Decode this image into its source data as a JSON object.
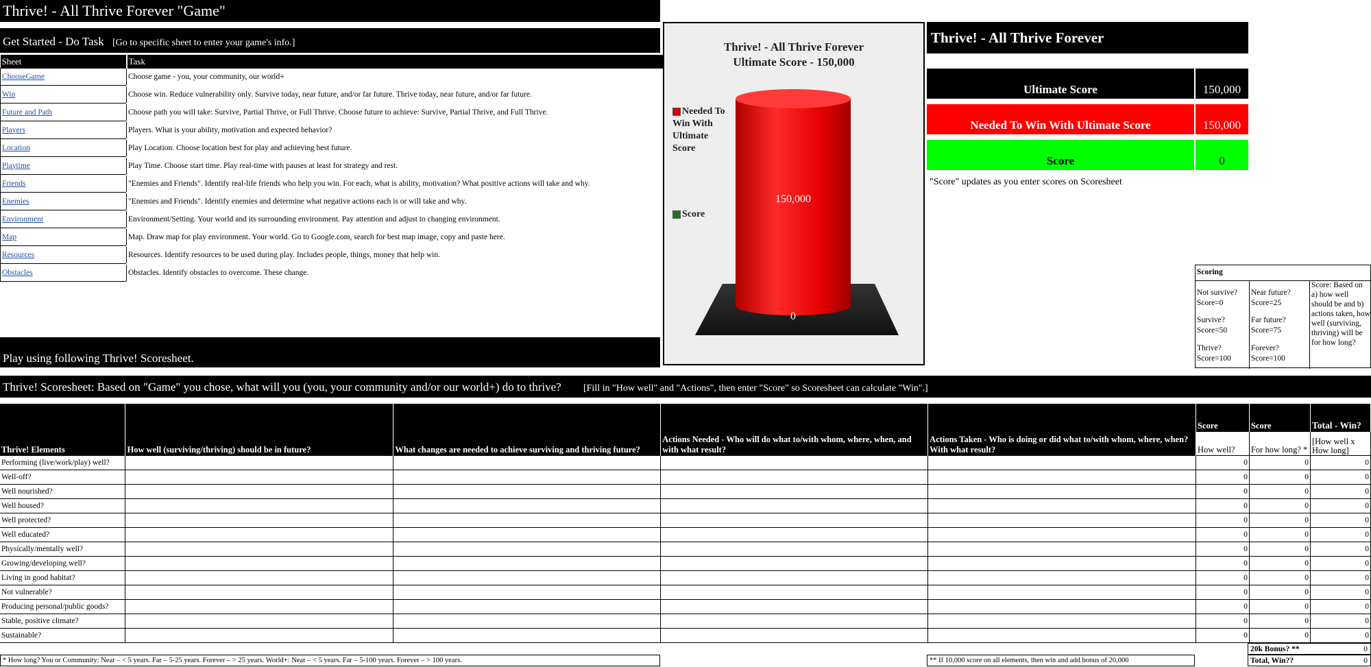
{
  "title": "Thrive! - All Thrive Forever \"Game\"",
  "get_started": {
    "heading": "Get Started - Do Task",
    "hint": "[Go to specific sheet to enter your game's info.]",
    "col_sheet": "Sheet",
    "col_task": "Task",
    "rows": [
      {
        "sheet": "ChooseGame",
        "task": "Choose game - you, your community, our world+"
      },
      {
        "sheet": "Win",
        "task": "Choose win. Reduce vulnerability only. Survive today, near future, and/or far future. Thrive today, near future, and/or far future."
      },
      {
        "sheet": "Future and Path",
        "task": "Choose path you will take: Survive, Partial Thrive, or Full Thrive. Choose future to achieve: Survive, Partial Thrive, and Full Thrive."
      },
      {
        "sheet": "Players",
        "task": "Players. What is your ability, motivation and expected behavior?"
      },
      {
        "sheet": "Location",
        "task": "Play Location. Choose location best for play and achieving best future."
      },
      {
        "sheet": "Playtime",
        "task": "Play Time. Choose start time. Play real-time with pauses at least for strategy and rest."
      },
      {
        "sheet": "Friends",
        "task": "\"Enemies and Friends\". Identify real-life friends who help you win. For each, what is ability, motivation? What positive actions will take and why."
      },
      {
        "sheet": "Enemies",
        "task": "\"Enemies and Friends\". Identify enemies and determine what negative actions each is or will take and why."
      },
      {
        "sheet": "Environment",
        "task": "Environment/Setting. Your world and its surrounding environment. Pay attention and adjust to changing environment."
      },
      {
        "sheet": "Map",
        "task": "Map. Draw map for play environment. Your world. Go to Google.com, search for best map image, copy and paste here."
      },
      {
        "sheet": "Resources",
        "task": "Resources. Identify resources to be used during play. Includes people, things, money that help win."
      },
      {
        "sheet": "Obstacles",
        "task": "Obstacles. Identify obstacles to overcome. These change."
      }
    ]
  },
  "play_banner": "Play using following Thrive! Scoresheet.",
  "chart_data": {
    "type": "bar",
    "title_line1": "Thrive! - All Thrive Forever",
    "title_line2": "Ultimate Score - 150,000",
    "series": [
      {
        "name": "Needed To Win With Ultimate Score",
        "values": [
          150000
        ],
        "color": "#e00000",
        "label": "150,000"
      },
      {
        "name": "Score",
        "values": [
          0
        ],
        "color": "#1a7a1a",
        "label": "0"
      }
    ],
    "ylim": [
      0,
      150000
    ]
  },
  "summary": {
    "header": "Thrive! - All Thrive Forever",
    "ultimate_label": "Ultimate Score",
    "ultimate_value": "150,000",
    "needed_label": "Needed To Win With Ultimate Score",
    "needed_value": "150,000",
    "score_label": "Score",
    "score_value": "0",
    "note": "\"Score\" updates as you enter scores on Scoresheet",
    "colors": {
      "needed": "#ff0000",
      "score": "#00ff00",
      "header": "#000000"
    }
  },
  "scoring": {
    "heading": "Scoring",
    "c1": [
      "Not survive?",
      "Score=0",
      "Survive?",
      "Score=50",
      "Thrive?",
      "Score=100"
    ],
    "c2": [
      "Near future?",
      "Score=25",
      "Far future?",
      "Score=75",
      "Forever?",
      "Score=100"
    ],
    "c3": "Score: Based on a) how well should be and b) actions taken, how well (surviving, thriving) will be for how long?"
  },
  "scoresheet": {
    "heading": "Thrive! Scoresheet: Based on \"Game\" you chose, what will you (you, your community and/or our world+) do to thrive?",
    "hint": "[Fill in \"How well\" and \"Actions\", then enter \"Score\" so Scoresheet can calculate \"Win\".]",
    "headers": {
      "elements": "Thrive! Elements",
      "how_well": "How well (surviving/thriving) should be in future?",
      "changes": "What changes are needed to achieve surviving and thriving future?",
      "needed": "Actions Needed  - Who will do what to/with whom, where, when, and with what result?",
      "taken": "Actions Taken  - Who is doing or did what to/with whom, where, when? With what result?",
      "score1": "Score",
      "score2": "Score",
      "total": "Total - Win?",
      "sub1": "How well?",
      "sub2": "For how long? *",
      "sub3": "[How well x How long]"
    },
    "rows": [
      "Performing (live/work/play) well?",
      "Well-off?",
      "Well nourished?",
      "Well housed?",
      "Well protected?",
      "Well educated?",
      "Physically/mentally well?",
      "Growing/developing well?",
      "Living in good habitat?",
      "Not vulnerable?",
      "Producing personal/public goods?",
      "Stable, positive climate?",
      "Sustainable?"
    ],
    "zero": "0",
    "bonus_label": "20k Bonus? **",
    "bonus_value": "0",
    "total_label": "Total, Win??",
    "total_value": "0",
    "foot_left": "* How long?  You or Community: Near – < 5 years. Far – 5-25 years. Forever – > 25 years.    World+: Near – < 5 years. Far – 5-100 years. Forever – > 100 years.",
    "foot_right": "** If 10,000 score on all elements, then win and add bonus of 20,000"
  }
}
